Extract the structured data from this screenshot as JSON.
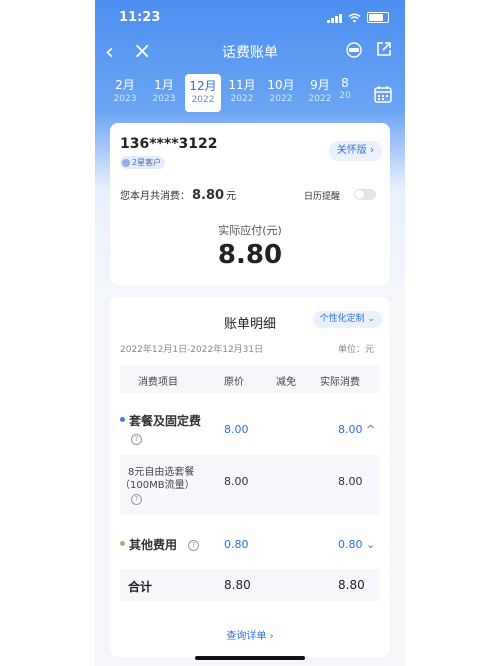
{
  "status": {
    "time": "11:23"
  },
  "nav": {
    "title": "话费账单"
  },
  "months": [
    {
      "m": "2月",
      "y": "2023"
    },
    {
      "m": "1月",
      "y": "2023"
    },
    {
      "m": "12月",
      "y": "2022"
    },
    {
      "m": "11月",
      "y": "2022"
    },
    {
      "m": "10月",
      "y": "2022"
    },
    {
      "m": "9月",
      "y": "2022"
    },
    {
      "m": "8",
      "y": "20"
    }
  ],
  "summary": {
    "phone": "136****3122",
    "badge": "2星客户",
    "care_label": "关怀版 ›",
    "spend_prefix": "您本月共消费：",
    "spend_amount": "8.80",
    "spend_unit": "元",
    "calendar_reminder": "日历提醒",
    "due_label": "实际应付(元)",
    "due_amount": "8.80"
  },
  "detail": {
    "title": "账单明细",
    "custom_label": "个性化定制 ⌄",
    "range": "2022年12月1日-2022年12月31日",
    "unit": "单位：元",
    "headers": [
      "消费项目",
      "原价",
      "减免",
      "实际消费"
    ],
    "rows": [
      {
        "name": "套餐及固定费",
        "orig": "8.00",
        "actual": "8.00 ^"
      },
      {
        "name1": "8元自由选套餐",
        "name2": "（100MB流量）",
        "orig": "8.00",
        "actual": "8.00"
      },
      {
        "name": "其他费用",
        "orig": "0.80",
        "actual": "0.80 ⌄"
      }
    ],
    "total": {
      "label": "合计",
      "orig": "8.80",
      "actual": "8.80"
    },
    "more": "查询详单 ›"
  },
  "colors": {
    "accent": "#2f6fe0",
    "header": "#4c8ef0",
    "bullet_blue": "#3c7be8",
    "bullet_gold": "#b8a66a"
  }
}
